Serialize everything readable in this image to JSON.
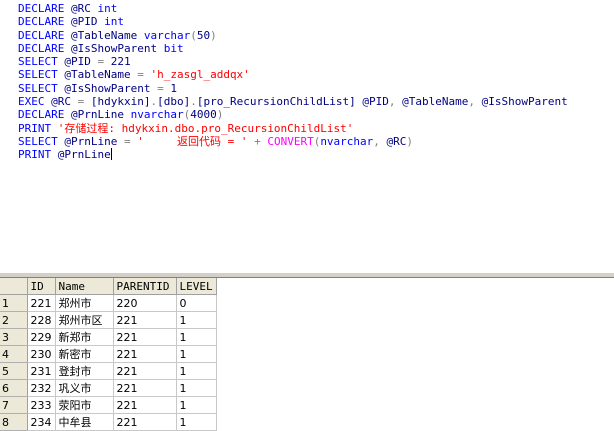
{
  "query_lines": [
    [
      {
        "t": "DECLARE ",
        "c": "kw"
      },
      {
        "t": "@RC ",
        "c": "pl"
      },
      {
        "t": "int",
        "c": "kw"
      }
    ],
    [
      {
        "t": "DECLARE ",
        "c": "kw"
      },
      {
        "t": "@PID ",
        "c": "pl"
      },
      {
        "t": "int",
        "c": "kw"
      }
    ],
    [
      {
        "t": "DECLARE ",
        "c": "kw"
      },
      {
        "t": "@TableName ",
        "c": "pl"
      },
      {
        "t": "varchar",
        "c": "kw"
      },
      {
        "t": "(",
        "c": "gr"
      },
      {
        "t": "50",
        "c": "pl"
      },
      {
        "t": ")",
        "c": "gr"
      }
    ],
    [
      {
        "t": "DECLARE ",
        "c": "kw"
      },
      {
        "t": "@IsShowParent ",
        "c": "pl"
      },
      {
        "t": "bit",
        "c": "kw"
      }
    ],
    [
      {
        "t": "SELECT ",
        "c": "kw"
      },
      {
        "t": "@PID ",
        "c": "pl"
      },
      {
        "t": "= ",
        "c": "gr"
      },
      {
        "t": "221",
        "c": "pl"
      }
    ],
    [
      {
        "t": "SELECT ",
        "c": "kw"
      },
      {
        "t": "@TableName ",
        "c": "pl"
      },
      {
        "t": "= ",
        "c": "gr"
      },
      {
        "t": "'h_zasgl_addqx'",
        "c": "str"
      }
    ],
    [
      {
        "t": "SELECT ",
        "c": "kw"
      },
      {
        "t": "@IsShowParent ",
        "c": "pl"
      },
      {
        "t": "= ",
        "c": "gr"
      },
      {
        "t": "1",
        "c": "pl"
      }
    ],
    [
      {
        "t": "EXEC ",
        "c": "kw"
      },
      {
        "t": "@RC ",
        "c": "pl"
      },
      {
        "t": "= ",
        "c": "gr"
      },
      {
        "t": "[hdykxin]",
        "c": "pl"
      },
      {
        "t": ".",
        "c": "gr"
      },
      {
        "t": "[dbo]",
        "c": "pl"
      },
      {
        "t": ".",
        "c": "gr"
      },
      {
        "t": "[pro_RecursionChildList] @PID",
        "c": "pl"
      },
      {
        "t": ", ",
        "c": "gr"
      },
      {
        "t": "@TableName",
        "c": "pl"
      },
      {
        "t": ", ",
        "c": "gr"
      },
      {
        "t": "@IsShowParent",
        "c": "pl"
      }
    ],
    [
      {
        "t": "DECLARE ",
        "c": "kw"
      },
      {
        "t": "@PrnLine ",
        "c": "pl"
      },
      {
        "t": "nvarchar",
        "c": "kw"
      },
      {
        "t": "(",
        "c": "gr"
      },
      {
        "t": "4000",
        "c": "pl"
      },
      {
        "t": ")",
        "c": "gr"
      }
    ],
    [
      {
        "t": "PRINT ",
        "c": "kw"
      },
      {
        "t": "'存储过程: hdykxin.dbo.pro_RecursionChildList'",
        "c": "str"
      }
    ],
    [
      {
        "t": "SELECT ",
        "c": "kw"
      },
      {
        "t": "@PrnLine ",
        "c": "pl"
      },
      {
        "t": "= ",
        "c": "gr"
      },
      {
        "t": "'     返回代码 = '",
        "c": "str"
      },
      {
        "t": " + ",
        "c": "gr"
      },
      {
        "t": "CONVERT",
        "c": "fn"
      },
      {
        "t": "(",
        "c": "gr"
      },
      {
        "t": "nvarchar",
        "c": "kw"
      },
      {
        "t": ", ",
        "c": "gr"
      },
      {
        "t": "@RC",
        "c": "pl"
      },
      {
        "t": ")",
        "c": "gr"
      }
    ],
    [
      {
        "t": "PRINT ",
        "c": "kw"
      },
      {
        "t": "@PrnLine",
        "c": "pl"
      },
      {
        "t": "",
        "c": "caret"
      }
    ]
  ],
  "results": {
    "columns": [
      "ID",
      "Name",
      "PARENTID",
      "LEVEL"
    ],
    "rows": [
      {
        "num": "1",
        "cells": [
          "221",
          "郑州市",
          "220",
          "0"
        ]
      },
      {
        "num": "2",
        "cells": [
          "228",
          "郑州市区",
          "221",
          "1"
        ]
      },
      {
        "num": "3",
        "cells": [
          "229",
          "新郑市",
          "221",
          "1"
        ]
      },
      {
        "num": "4",
        "cells": [
          "230",
          "新密市",
          "221",
          "1"
        ]
      },
      {
        "num": "5",
        "cells": [
          "231",
          "登封市",
          "221",
          "1"
        ]
      },
      {
        "num": "6",
        "cells": [
          "232",
          "巩义市",
          "221",
          "1"
        ]
      },
      {
        "num": "7",
        "cells": [
          "233",
          "荥阳市",
          "221",
          "1"
        ]
      },
      {
        "num": "8",
        "cells": [
          "234",
          "中牟县",
          "221",
          "1"
        ]
      }
    ]
  }
}
